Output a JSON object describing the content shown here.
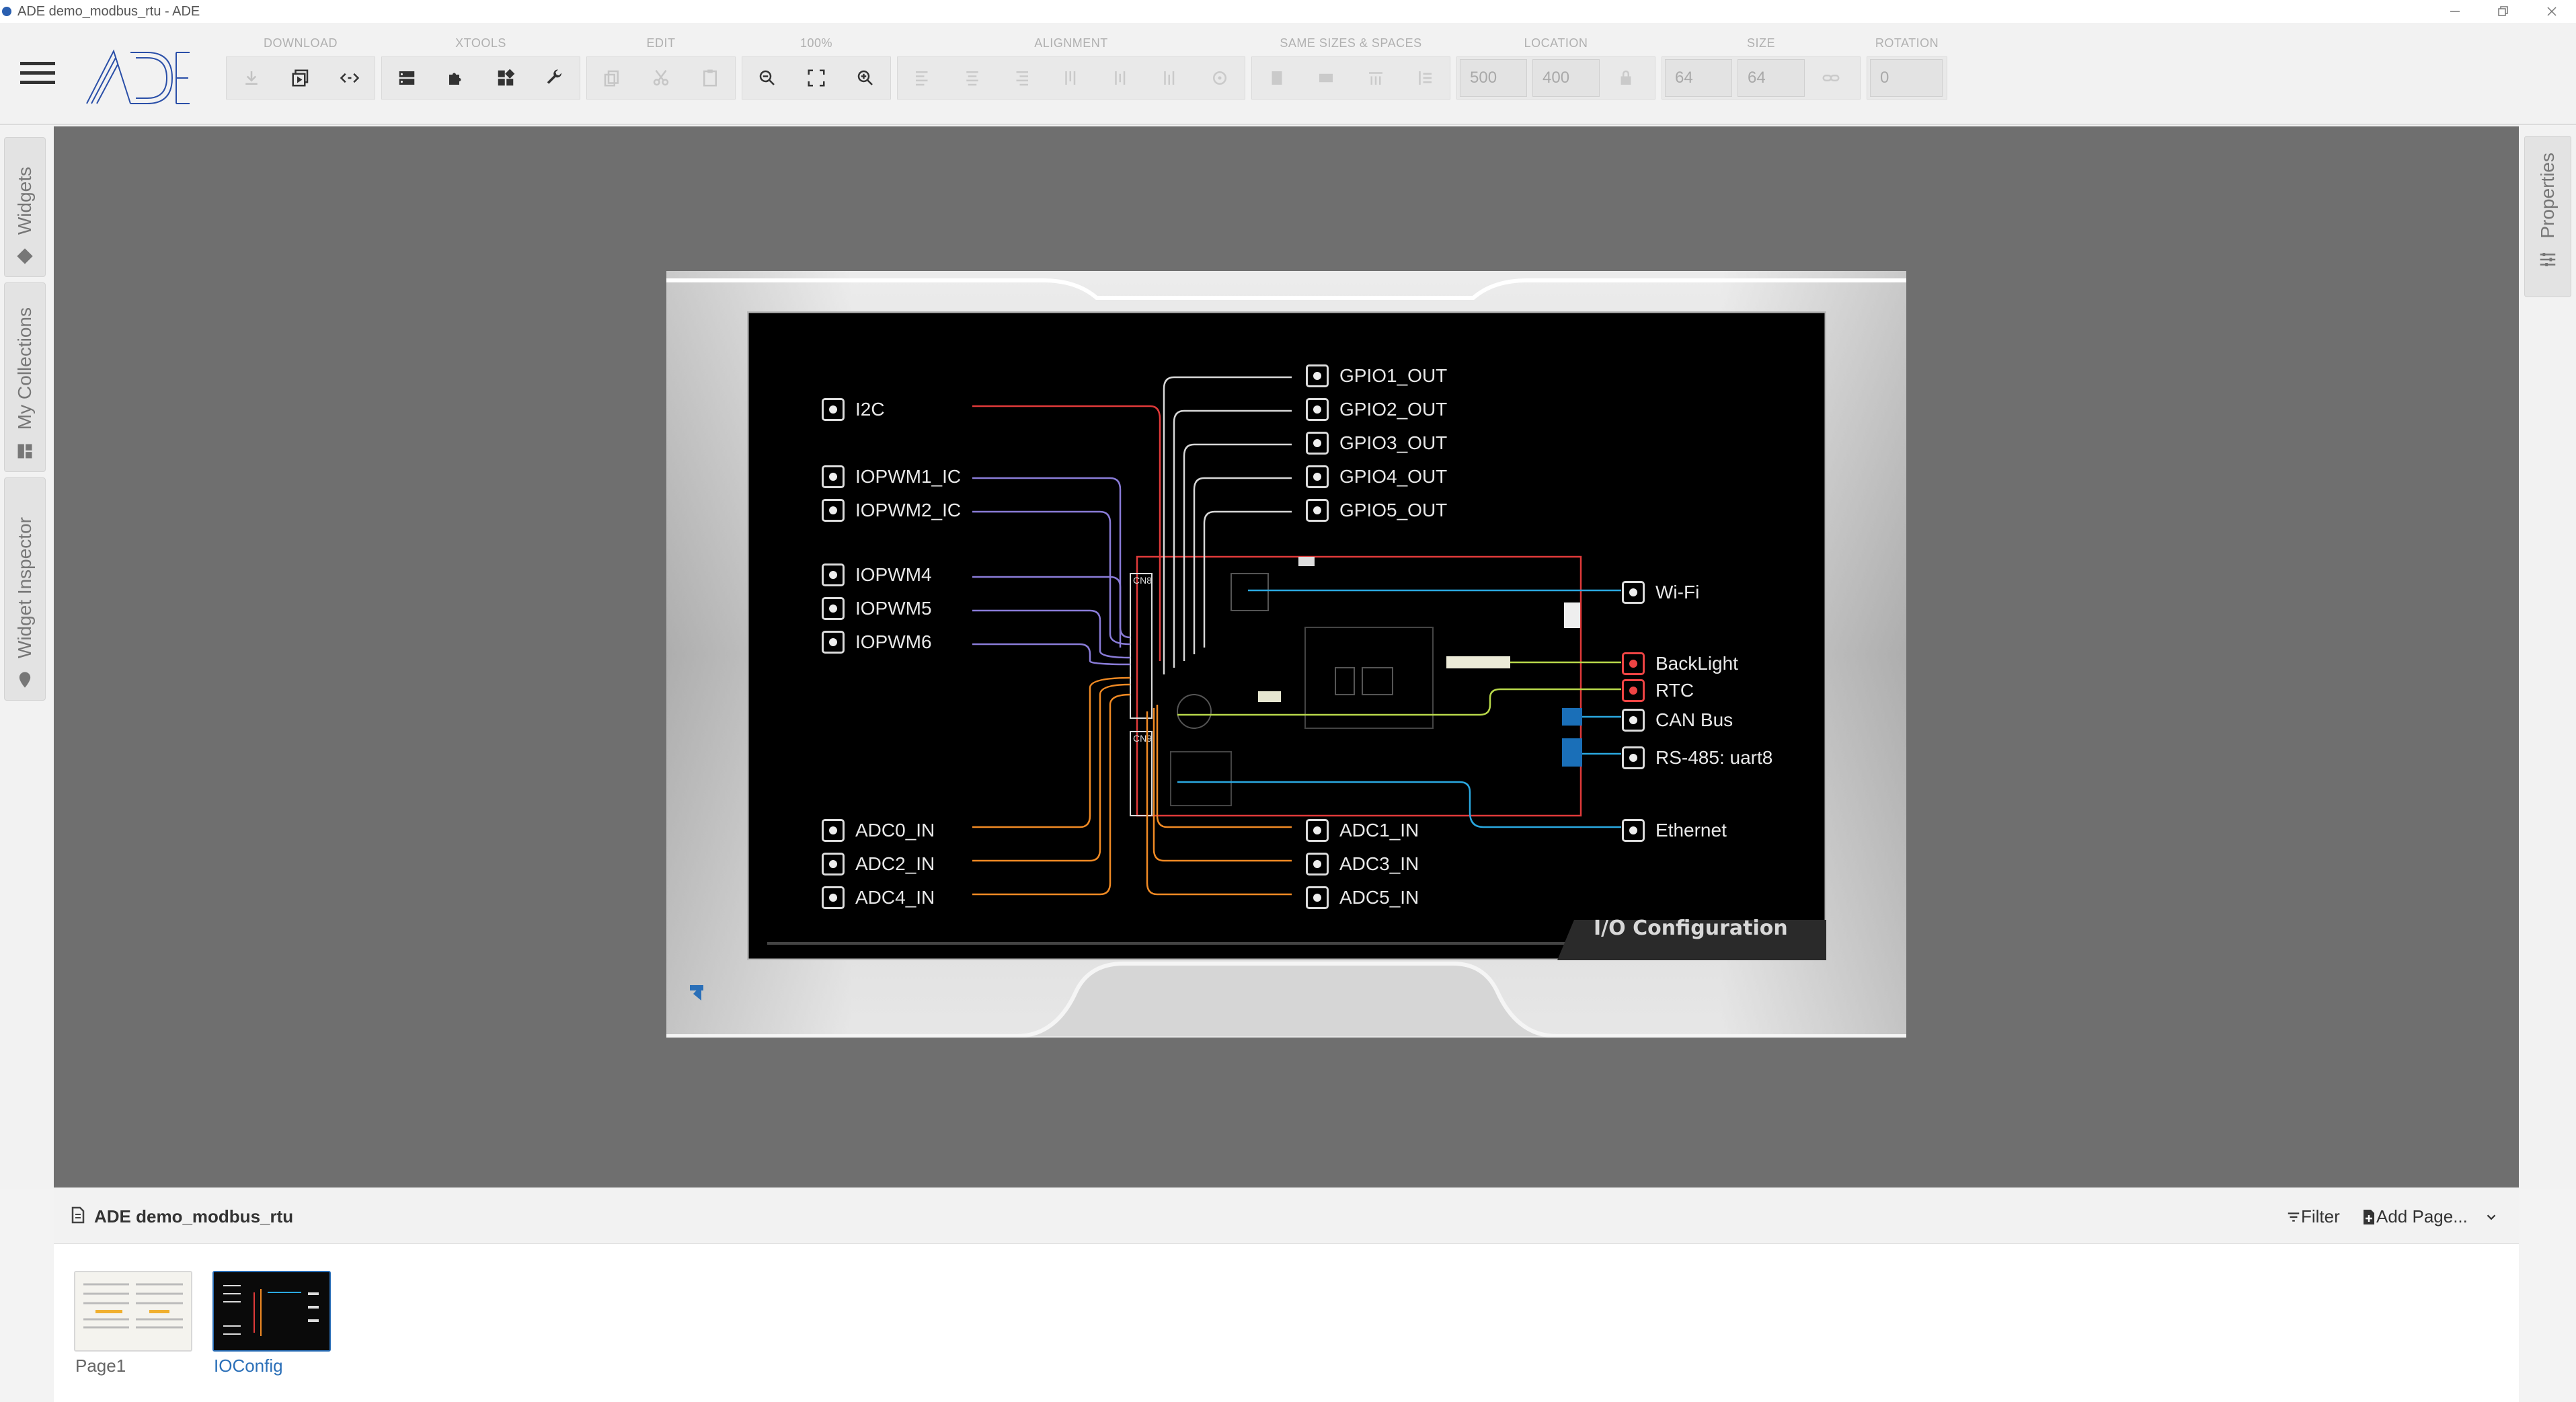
{
  "window": {
    "title": "ADE demo_modbus_rtu - ADE",
    "controls": [
      "minimize-icon",
      "restore-icon",
      "close-icon"
    ]
  },
  "toolbar": {
    "groups": [
      {
        "label": "DOWNLOAD",
        "buttons": [
          "download-icon",
          "preview-icon",
          "code-icon"
        ]
      },
      {
        "label": "XTOOLS",
        "buttons": [
          "server-icon",
          "puzzle-icon",
          "widgets-icon",
          "wrench-icon"
        ]
      },
      {
        "label": "EDIT",
        "buttons": [
          "copy-icon",
          "cut-icon",
          "paste-icon"
        ]
      },
      {
        "label": "100%",
        "buttons": [
          "zoom-out-icon",
          "fit-icon",
          "zoom-in-icon"
        ]
      },
      {
        "label": "ALIGNMENT",
        "buttons": [
          "align-left-icon",
          "align-center-icon",
          "align-right-icon",
          "align-top-icon",
          "align-middle-icon",
          "align-bottom-icon",
          "align-target-icon"
        ]
      },
      {
        "label": "SAME SIZES & SPACES",
        "buttons": [
          "same-width-icon",
          "same-height-icon",
          "space-h-icon",
          "space-v-icon"
        ]
      },
      {
        "label": "LOCATION"
      },
      {
        "label": "SIZE"
      },
      {
        "label": "ROTATION"
      }
    ],
    "location_x": "500",
    "location_y": "400",
    "size_w": "64",
    "size_h": "64",
    "rotation": "0"
  },
  "left_rail": {
    "tabs": [
      {
        "label": "Widgets",
        "icon": "widgets-diamond-icon"
      },
      {
        "label": "My Collections",
        "icon": "collections-icon"
      },
      {
        "label": "Widget Inspector",
        "icon": "inspector-pin-icon"
      }
    ]
  },
  "right_rail": {
    "tabs": [
      {
        "label": "Properties",
        "icon": "sliders-icon"
      }
    ]
  },
  "design": {
    "left_pins": [
      "I2C",
      "IOPWM1_IC",
      "IOPWM2_IC",
      "IOPWM4",
      "IOPWM5",
      "IOPWM6",
      "ADC0_IN",
      "ADC2_IN",
      "ADC4_IN"
    ],
    "top_pins": [
      "GPIO1_OUT",
      "GPIO2_OUT",
      "GPIO3_OUT",
      "GPIO4_OUT",
      "GPIO5_OUT"
    ],
    "bottom_pins": [
      "ADC1_IN",
      "ADC3_IN",
      "ADC5_IN"
    ],
    "right_pins": [
      "Wi-Fi",
      "BackLight",
      "RTC",
      "CAN Bus",
      "RS-485: uart8",
      "Ethernet"
    ],
    "connector_labels": [
      "CN8",
      "CN9"
    ],
    "panel_title": "I/O Configuration"
  },
  "pages_panel": {
    "project_name": "ADE demo_modbus_rtu",
    "filter_label": "Filter",
    "add_page_label": "Add Page...",
    "pages": [
      {
        "name": "Page1",
        "selected": false
      },
      {
        "name": "IOConfig",
        "selected": true
      }
    ]
  },
  "colors": {
    "canvas": "#6f6f6f",
    "screen": "#000000",
    "wire_red": "#e03a3a",
    "wire_purple": "#8a7cd8",
    "wire_orange": "#f08a24",
    "wire_white": "#d8d8d8",
    "wire_blue": "#2aa8e0",
    "wire_green": "#b8d84a",
    "link_blue": "#2a6fb8"
  }
}
